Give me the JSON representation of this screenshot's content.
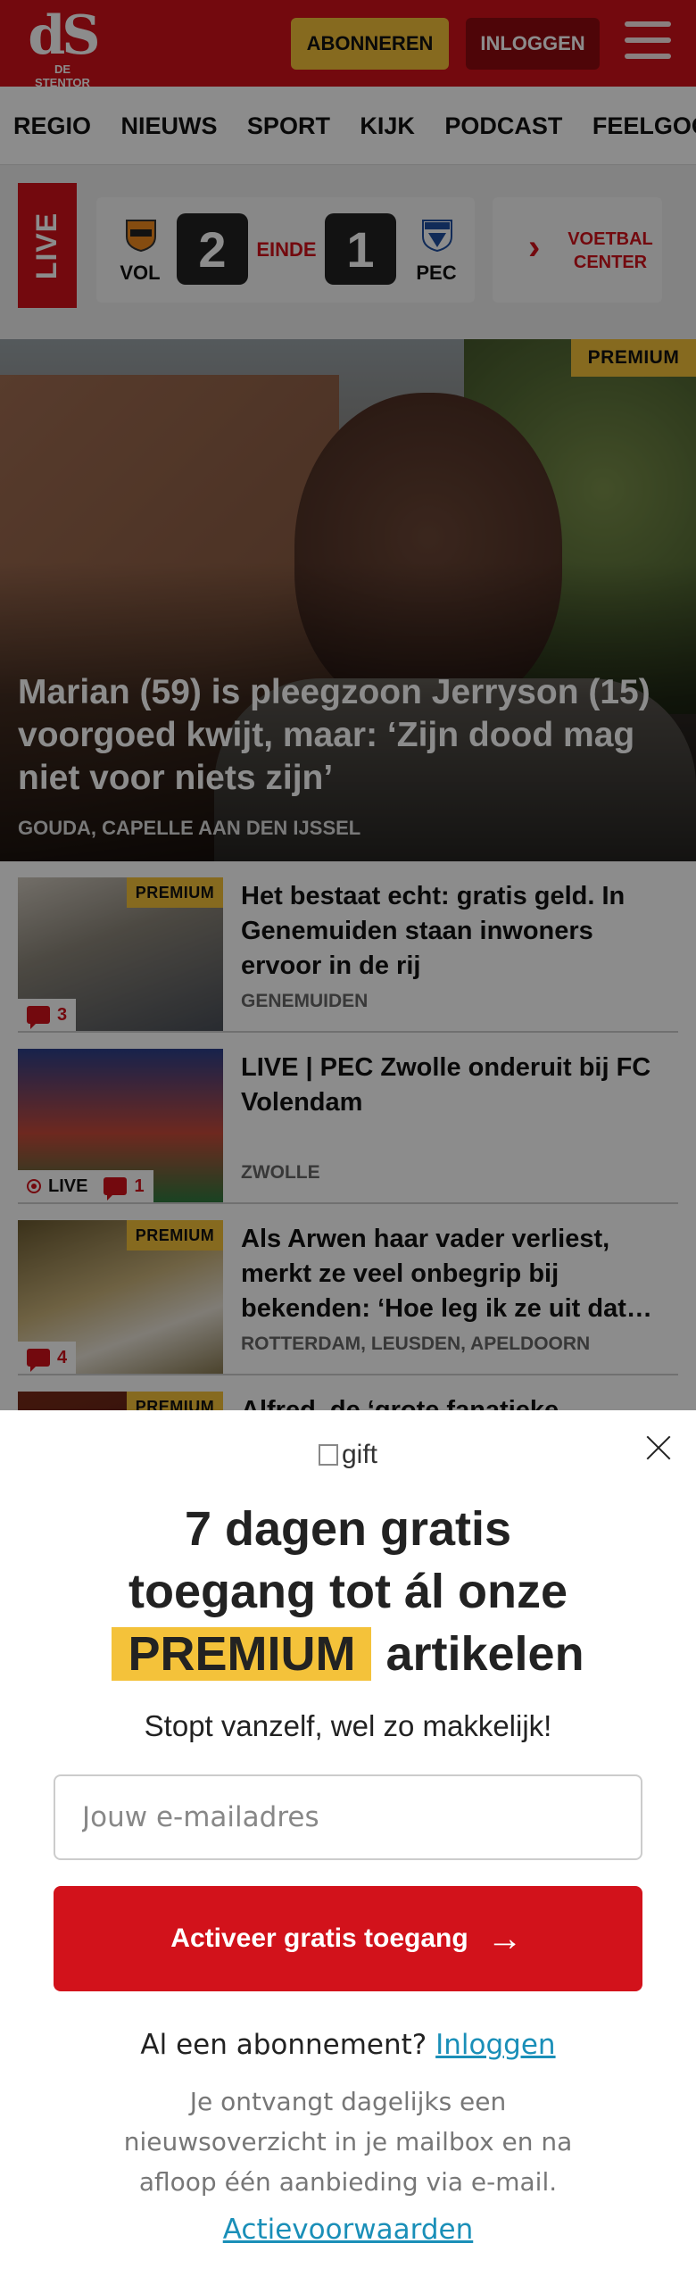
{
  "header": {
    "logo_mark": "dS",
    "logo_name": "DE STENTOR",
    "subscribe_label": "ABONNEREN",
    "login_label": "INLOGGEN"
  },
  "nav": {
    "items": [
      "REGIO",
      "NIEUWS",
      "SPORT",
      "KIJK",
      "PODCAST",
      "FEELGOOD"
    ]
  },
  "live_score": {
    "live_label": "LIVE",
    "home_team": "VOL",
    "away_team": "PEC",
    "home_score": "2",
    "away_score": "1",
    "status": "EINDE",
    "voetbal_center_label": "VOETBAL CENTER"
  },
  "hero": {
    "badge": "PREMIUM",
    "title": "Marian (59) is pleegzoon Jerryson (15) voorgoed kwijt, maar: ‘Zijn dood mag niet voor niets zijn’",
    "location": "GOUDA, CAPELLE AAN DEN IJSSEL"
  },
  "articles": [
    {
      "badge": "PREMIUM",
      "comments": "3",
      "title": "Het bestaat echt: gratis geld. In Genemuiden staan inwoners ervoor in de rij",
      "location": "GENEMUIDEN"
    },
    {
      "live_label": "LIVE",
      "comments": "1",
      "title": "LIVE | PEC Zwolle onderuit bij FC Volendam",
      "location": "ZWOLLE"
    },
    {
      "badge": "PREMIUM",
      "comments": "4",
      "title": "Als Arwen haar vader verliest, merkt ze veel onbegrip bij bekenden: ‘Hoe leg ik ze uit dat…",
      "location": "ROTTERDAM, LEUSDEN, APELDOORN"
    },
    {
      "badge": "PREMIUM",
      "title": "Alfred, de ‘grote fanatieke"
    }
  ],
  "modal": {
    "gift_alt": "gift",
    "title_line1": "7 dagen gratis",
    "title_line2": "toegang tot ál onze",
    "title_highlight": "PREMIUM",
    "title_line3": "artikelen",
    "subtitle": "Stopt vanzelf, wel zo makkelijk!",
    "email_placeholder": "Jouw e-mailadres",
    "cta_label": "Activeer gratis toegang",
    "already_text": "Al een abonnement?",
    "login_link": "Inloggen",
    "note": "Je ontvangt dagelijks een nieuwsoverzicht in je mailbox en na afloop één aanbieding via e-mail.",
    "terms_link": "Actievoorwaarden"
  },
  "colors": {
    "brand_red": "#d2121b",
    "premium_yellow": "#f4c23a",
    "link_blue": "#1a8fb8"
  }
}
